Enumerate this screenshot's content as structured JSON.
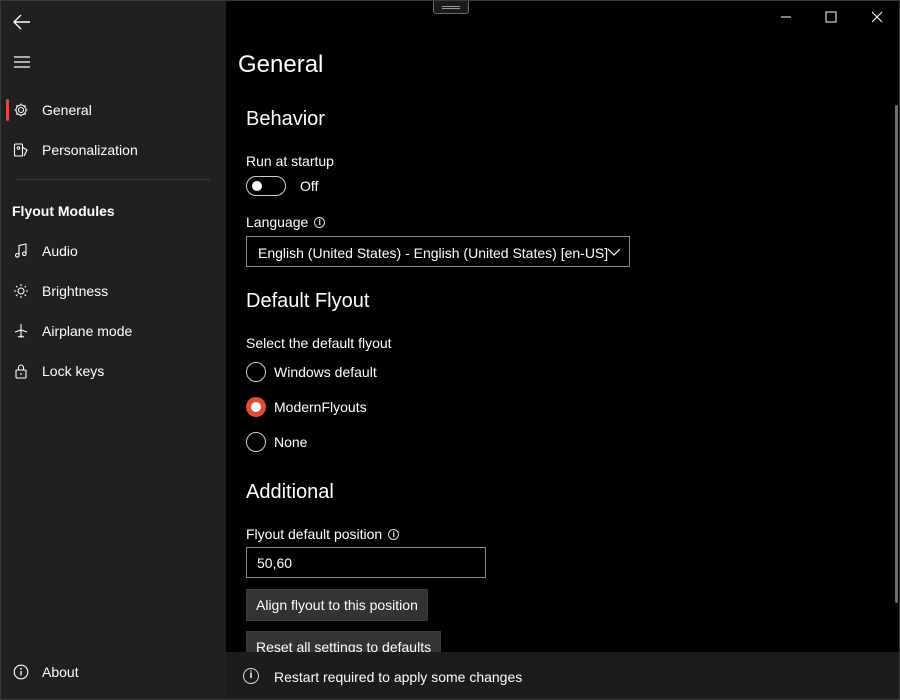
{
  "sidebar": {
    "back_icon": "back-arrow-icon",
    "menu_icon": "hamburger-icon",
    "items": [
      {
        "label": "General",
        "icon": "gear-icon",
        "selected": true
      },
      {
        "label": "Personalization",
        "icon": "personalization-icon"
      }
    ],
    "section_header": "Flyout Modules",
    "modules": [
      {
        "label": "Audio",
        "icon": "music-note-icon"
      },
      {
        "label": "Brightness",
        "icon": "sun-icon"
      },
      {
        "label": "Airplane mode",
        "icon": "airplane-icon"
      },
      {
        "label": "Lock keys",
        "icon": "lock-icon"
      }
    ],
    "footer": {
      "label": "About",
      "icon": "info-icon"
    },
    "accent_color": "#e04e39"
  },
  "main": {
    "page_title": "General",
    "behavior": {
      "heading": "Behavior",
      "run_at_startup_label": "Run at startup",
      "run_at_startup_state": "Off",
      "language_label": "Language",
      "language_value": "English (United States) - English (United States) [en-US]"
    },
    "default_flyout": {
      "heading": "Default Flyout",
      "prompt": "Select the default flyout",
      "options": [
        "Windows default",
        "ModernFlyouts",
        "None"
      ],
      "selected": "ModernFlyouts"
    },
    "additional": {
      "heading": "Additional",
      "position_label": "Flyout default position",
      "position_value": "50,60",
      "align_button": "Align flyout to this position",
      "reset_button": "Reset all settings to defaults"
    }
  },
  "infobar": {
    "message": "Restart required to apply some changes",
    "icon": "info-icon"
  }
}
